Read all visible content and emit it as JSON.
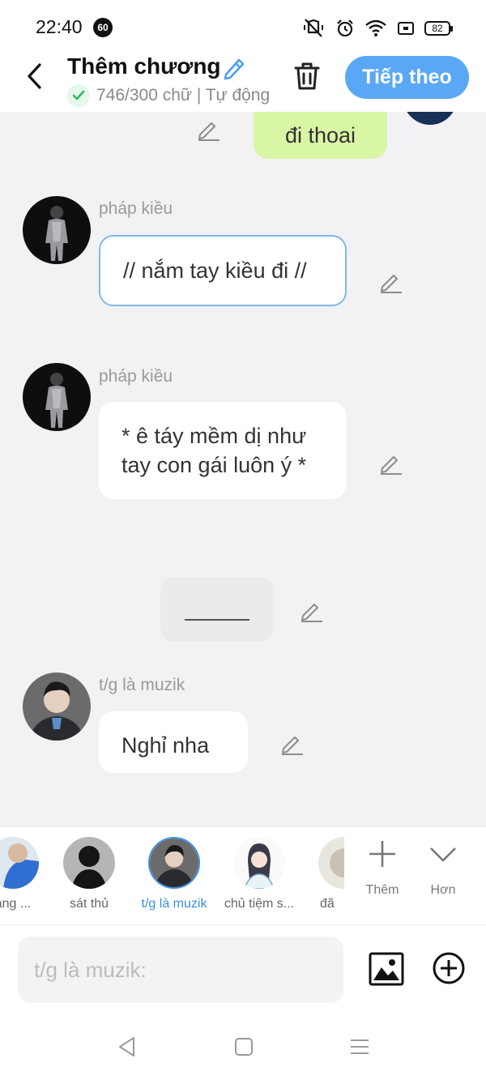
{
  "status_bar": {
    "time": "22:40",
    "badge": "60",
    "battery": "82"
  },
  "header": {
    "title": "Thêm chương",
    "subtitle": "746/300 chữ | Tự động",
    "next_label": "Tiếp theo"
  },
  "messages": [
    {
      "type": "mine",
      "text": "đi thoai"
    },
    {
      "type": "other",
      "sender": "pháp kiều",
      "text": "// nắm tay kiều đi //"
    },
    {
      "type": "other",
      "sender": "pháp kiều",
      "text": "* ê táy mềm dị như tay con gái luôn ý *"
    },
    {
      "type": "divider"
    },
    {
      "type": "other",
      "sender": "t/g là muzik",
      "text": "Nghỉ nha"
    }
  ],
  "characters": [
    {
      "name": "ang ..."
    },
    {
      "name": "sát thủ"
    },
    {
      "name": "t/g là muzik",
      "selected": true
    },
    {
      "name": "chủ tiệm s..."
    },
    {
      "name": "đã"
    }
  ],
  "tools": {
    "add_label": "Thêm",
    "more_label": "Hơn"
  },
  "input": {
    "placeholder": "t/g là muzik:"
  },
  "colors": {
    "accent": "#5aa7f5",
    "my_bubble": "#d9f6a4",
    "selected_name": "#3b8fe0"
  }
}
